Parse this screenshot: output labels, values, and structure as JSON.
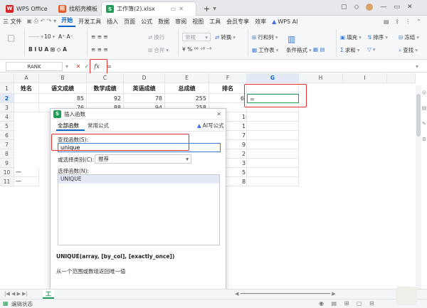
{
  "tabs": {
    "wps_office": "WPS Office",
    "template": "找稻壳模板",
    "workbook": "工作簿(2).xlsx",
    "add": "+"
  },
  "menu": {
    "file": "三 文件",
    "items": [
      "开始",
      "开发工具",
      "插入",
      "页面",
      "公式",
      "数据",
      "审阅",
      "视图",
      "工具",
      "会员专享",
      "效率"
    ],
    "wps_ai": "WPS AI"
  },
  "ribbon": {
    "font_size": "10",
    "wrap": "换行",
    "merge": "合并",
    "format_general": "常规",
    "convert": "转换",
    "row_col": "行和列",
    "worksheet": "工作表",
    "cond_format": "条件格式",
    "fill": "填充",
    "sum": "求和",
    "filter": "排序",
    "find": "查找",
    "freeze": "冻结"
  },
  "formula_bar": {
    "name_box": "RANK",
    "cancel": "✕",
    "confirm": "✓",
    "fx": "fx",
    "content": "="
  },
  "sheet": {
    "columns": [
      "A",
      "B",
      "C",
      "D",
      "E",
      "F",
      "G",
      "H",
      "I"
    ],
    "rows": [
      "1",
      "2",
      "3",
      "4",
      "5",
      "6",
      "7",
      "8",
      "9",
      "10",
      "11"
    ],
    "headers": [
      "姓名",
      "语文成绩",
      "数学成绩",
      "英语成绩",
      "总成绩",
      "排名"
    ],
    "row2": [
      "85",
      "92",
      "78",
      "255"
    ],
    "row3": [
      "76",
      "88",
      "94",
      "258"
    ],
    "col_g": [
      "=",
      "",
      "",
      "",
      "",
      "",
      "",
      "",
      ""
    ],
    "col_f_right": [
      "6",
      "",
      "10",
      "1",
      "7",
      "9",
      "2",
      "3",
      "5",
      "8"
    ],
    "col_a_dash": [
      "一",
      "一"
    ]
  },
  "dialog": {
    "title": "插入函数",
    "tab_all": "全部函数",
    "tab_common": "常用公式",
    "ai_formula": "AI写公式",
    "search_label": "查找函数(S):",
    "search_value": "unique",
    "category_label": "或选择类别(C):",
    "category_value": "推荐",
    "select_label": "选择函数(N):",
    "list": [
      "UNIQUE"
    ],
    "signature": "UNIQUE(array, [by_col], [exactly_once])",
    "description": "从一个范围或数组返回唯一值"
  },
  "sheet_tabs": {
    "current": "工"
  },
  "status": {
    "edit_state": "编辑状态"
  },
  "colors": {
    "accent": "#0b64c8",
    "highlight_red": "#e0312e",
    "selected_green": "#1f9d55"
  }
}
